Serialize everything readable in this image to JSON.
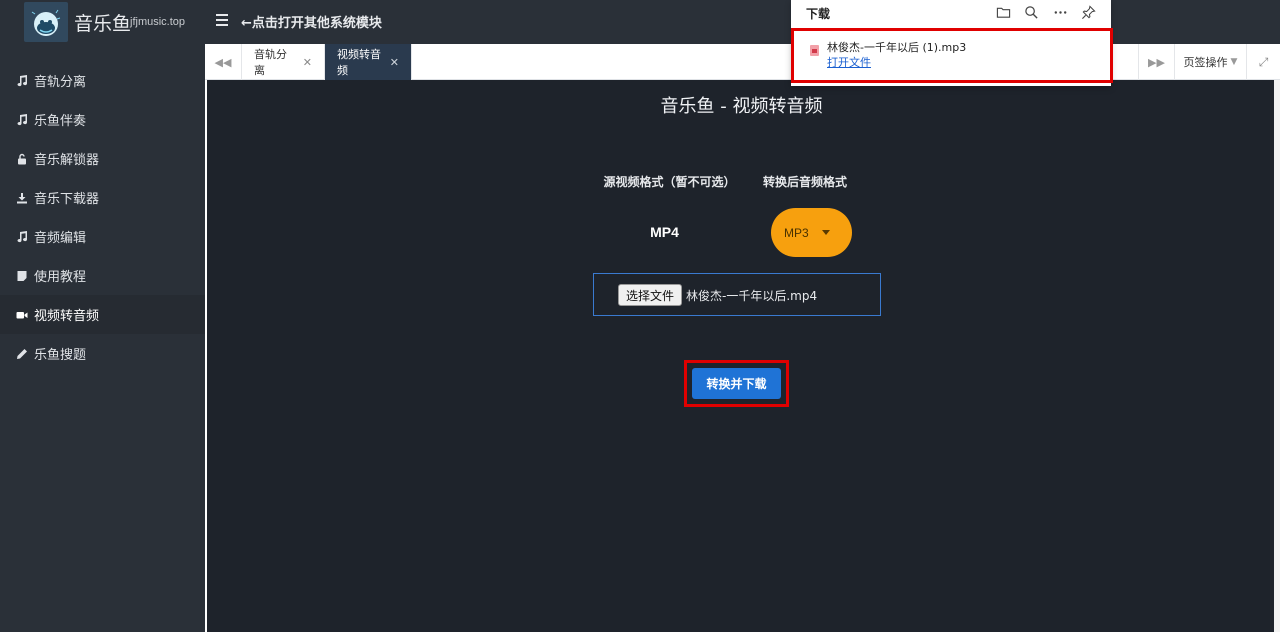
{
  "header": {
    "app_name": "音乐鱼",
    "app_domain": "jfjmusic.top",
    "menu_hint": "←点击打开其他系统模块"
  },
  "sidebar": {
    "items": [
      {
        "label": "音轨分离",
        "icon": "music-note-icon"
      },
      {
        "label": "乐鱼伴奏",
        "icon": "music-note-icon"
      },
      {
        "label": "音乐解锁器",
        "icon": "unlock-icon"
      },
      {
        "label": "音乐下载器",
        "icon": "download-icon"
      },
      {
        "label": "音频编辑",
        "icon": "music-note-icon"
      },
      {
        "label": "使用教程",
        "icon": "document-icon"
      },
      {
        "label": "视频转音频",
        "icon": "video-camera-icon",
        "active": true
      },
      {
        "label": "乐鱼搜题",
        "icon": "pencil-icon"
      }
    ]
  },
  "tabs": {
    "items": [
      {
        "label": "音轨分离",
        "active": false
      },
      {
        "label": "视频转音频",
        "active": true
      }
    ],
    "ops_label": "页签操作"
  },
  "main": {
    "title": "音乐鱼 - 视频转音频",
    "source_format_label": "源视频格式（暂不可选）",
    "target_format_label": "转换后音频格式",
    "source_format": "MP4",
    "target_format": "MP3",
    "file_button": "选择文件",
    "file_name": "林俊杰-一千年以后.mp4",
    "convert_button": "转换并下载"
  },
  "download_panel": {
    "title": "下载",
    "file_name": "林俊杰-一千年以后 (1).mp3",
    "open_file": "打开文件"
  },
  "colors": {
    "accent_orange": "#f7a00e",
    "primary_blue": "#1f73d6",
    "highlight_red": "#e00000",
    "bg_dark": "#1e232b",
    "sidebar_bg": "#2a3038"
  }
}
